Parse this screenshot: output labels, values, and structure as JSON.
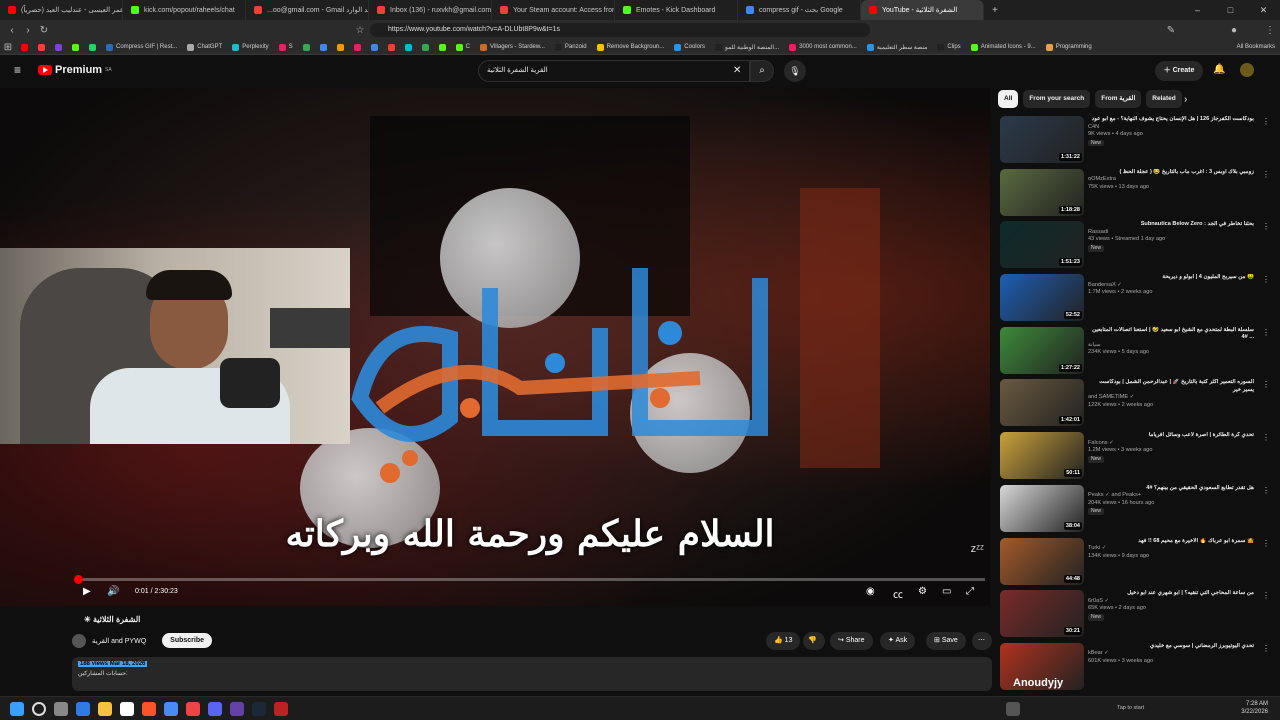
{
  "browser": {
    "tabs": [
      {
        "label": "عمر العيسى - عندليب العيد (حصرياً) | ...",
        "color": "#ff0000"
      },
      {
        "label": "kick.com/popout/raheels/chat",
        "color": "#53fc18"
      },
      {
        "label": "...oo@gmail.com - Gmail البريد الوارد",
        "color": "#ea4335"
      },
      {
        "label": "Inbox (136) - ruxvkh@gmail.com - G",
        "color": "#ea4335"
      },
      {
        "label": "Your Steam account: Access from ne...",
        "color": "#ea4335"
      },
      {
        "label": "Emotes - Kick Dashboard",
        "color": "#53fc18"
      },
      {
        "label": "compress gif - بحث Google",
        "color": "#4285f4"
      },
      {
        "label": "YouTube - الشفرة الثلاثية",
        "color": "#ff0000",
        "active": true
      }
    ],
    "url": "https://www.youtube.com/watch?v=A-DLUbt8P9w&t=1s",
    "bookmarks": [
      {
        "label": "",
        "color": "#ff0000"
      },
      {
        "label": "",
        "color": "#ff3b3b"
      },
      {
        "label": "",
        "color": "#7b3fe4"
      },
      {
        "label": "",
        "color": "#53fc18"
      },
      {
        "label": "",
        "color": "#25d366"
      },
      {
        "label": "Compress GIF | Rest...",
        "color": "#2b6cb0"
      },
      {
        "label": "ChatGPT",
        "color": "#aaaaaa"
      },
      {
        "label": "Perplexity",
        "color": "#20b8cd"
      },
      {
        "label": "S",
        "color": "#e91e63"
      },
      {
        "label": "",
        "color": "#34a853"
      },
      {
        "label": "",
        "color": "#4285f4"
      },
      {
        "label": "",
        "color": "#ff9800"
      },
      {
        "label": "",
        "color": "#e91e63"
      },
      {
        "label": "",
        "color": "#4285f4"
      },
      {
        "label": "",
        "color": "#ea4335"
      },
      {
        "label": "",
        "color": "#00bcd4"
      },
      {
        "label": "",
        "color": "#34a853"
      },
      {
        "label": "",
        "color": "#53fc18"
      },
      {
        "label": "C",
        "color": "#53fc18"
      },
      {
        "label": "Villagers - Stardew...",
        "color": "#d2691e"
      },
      {
        "label": "Panzoid",
        "color": "#222222"
      },
      {
        "label": "Remove Backgroun...",
        "color": "#ffc107"
      },
      {
        "label": "Coolors",
        "color": "#2196f3"
      },
      {
        "label": "المنصة الوطنية للمو...",
        "color": "#222222"
      },
      {
        "label": "3000 most common...",
        "color": "#e91e63"
      },
      {
        "label": "منصة سطر التعليمية",
        "color": "#2196f3"
      },
      {
        "label": "Clips",
        "color": "#222222"
      },
      {
        "label": "Animated Icons - 9...",
        "color": "#53fc18"
      },
      {
        "label": "Programming",
        "color": "#e6a23c"
      }
    ],
    "all_bookmarks": "All Bookmarks"
  },
  "youtube": {
    "logo_text": "Premium",
    "logo_region": "SA",
    "search_query": "القرية الشفرة الثلاثية",
    "create_label": "Create"
  },
  "video": {
    "subtitle": "السلام عليكم ورحمة الله وبركاته",
    "time": "0:01 / 2:30:23",
    "progress": 0.001,
    "title": "الشفرة الثلاثية",
    "channel": "القرية and PYWQ",
    "subscribe": "Subscribe",
    "likes": "13",
    "share": "Share",
    "ask": "Ask",
    "save": "Save",
    "views_date": "188 views  Mar 18, 2026",
    "desc_line": "حسابات المشاركين:"
  },
  "sidebar": {
    "chips": [
      "All",
      "From your search",
      "From القرية",
      "Related"
    ],
    "videos": [
      {
        "title": "بودكاست الكفرجاز 126 | هل الإنسان يحتاج يشوف النهاية؟ - مع أبو عود",
        "channel": "C4N",
        "meta": "9K views • 4 days ago",
        "duration": "1:31:22",
        "new": "New",
        "thumb": "#2b3a4a"
      },
      {
        "title": "زومبي بلاك اوبس 3 : اغرب ماب بالتاريخ 😂 ( عجلة الحظ )",
        "channel": "oOMzExtra",
        "meta": "75K views • 13 days ago",
        "duration": "1:18:28",
        "new": "",
        "thumb": "#5a6a40"
      },
      {
        "title": "Subnautica Below Zero : بحثنا تخاطر في الجد",
        "channel": "Rassadi",
        "meta": "43 views • Streamed 1 day ago",
        "duration": "1:51:23",
        "new": "New",
        "thumb": "#0e2a2a"
      },
      {
        "title": "من سيربح المليون 4 | ابولو و ديربحة 🤑",
        "channel": "BandersaX ✓",
        "meta": "1.7M views • 2 weeks ago",
        "duration": "52:52",
        "new": "",
        "thumb": "#1d5fb4"
      },
      {
        "title": "سلسلة البطة لمتحدي مع الشيخ أبو سعيد 🤣 | استعنا اتصالات المتابعين #4 ...",
        "channel": "سيانة",
        "meta": "234K views • 5 days ago",
        "duration": "1:27:22",
        "new": "",
        "thumb": "#3d8a3a"
      },
      {
        "title": "السوره التعمير أكثر كتبة بالتاريخ 🚀 | عبدالرحمن الشمل | بودكاست يسير خير",
        "channel": "and SAMETIME ✓",
        "meta": "122K views • 2 weeks ago",
        "duration": "1:42:01",
        "new": "",
        "thumb": "#6a5a40"
      },
      {
        "title": "تحدي كرة الطائرة | اصرة لاعب وسائل افرياما",
        "channel": "Falcons ✓",
        "meta": "1.2M views • 3 weeks ago",
        "duration": "50:11",
        "new": "New",
        "thumb": "#c9a23a"
      },
      {
        "title": "هل تقدر تطابع السعودي الحقيقي من بينهم؟ #4",
        "channel": "Peaks ✓ and Peaks+",
        "meta": "204K views • 16 hours ago",
        "duration": "38:04",
        "new": "New",
        "thumb": "#d8d8d8"
      },
      {
        "title": "سمرة ابو عرباك 🔥 الأخيرة مع محيم 68 !! فهد 🤷",
        "channel": "Turki ✓",
        "meta": "134K views • 9 days ago",
        "duration": "44:48",
        "new": "",
        "thumb": "#a35a2a"
      },
      {
        "title": "من ساعة المحاجي التي تنقيه؟ | ابو شهري عند ابو دخيل",
        "channel": "6r0aS ✓",
        "meta": "65K views • 2 days ago",
        "duration": "30:21",
        "new": "New",
        "thumb": "#7a2a2a"
      },
      {
        "title": "تحدي اليوتيوبرز الرمضاني | سوسي مع خليدي",
        "channel": "kBear ✓",
        "meta": "601K views • 3 weeks ago",
        "duration": "",
        "new": "",
        "thumb": "#b0321e"
      }
    ],
    "watermark": "Anoudyjy"
  },
  "taskbar": {
    "tap_to_start": "Tap to start",
    "time": "7:28 AM",
    "date": "3/22/2026"
  }
}
